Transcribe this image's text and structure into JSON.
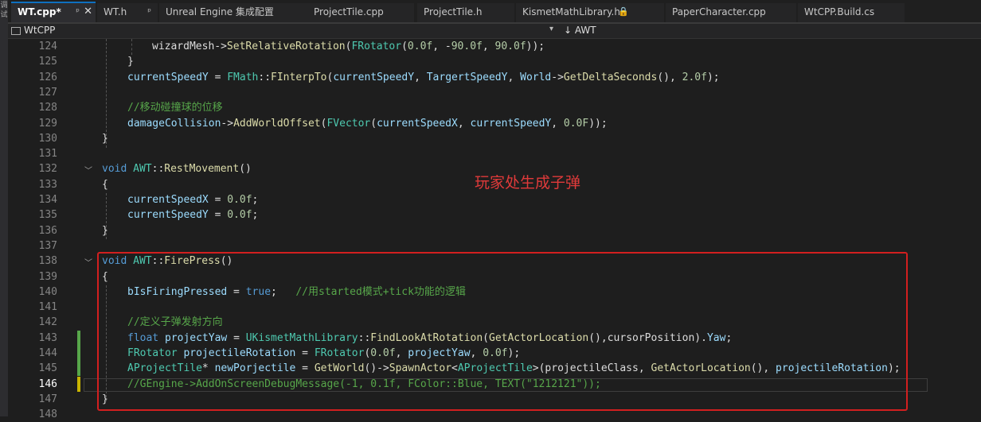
{
  "tabs": [
    {
      "label": "WT.cpp*",
      "active": true
    },
    {
      "label": "WT.h"
    },
    {
      "label": "Unreal Engine 集成配置"
    },
    {
      "label": "ProjectTile.cpp"
    },
    {
      "label": "ProjectTile.h"
    },
    {
      "label": "KismetMathLibrary.h"
    },
    {
      "label": "PaperCharacter.cpp"
    },
    {
      "label": "WtCPP.Build.cs"
    }
  ],
  "nav": {
    "project": "WtCPP",
    "class": "AWT"
  },
  "annotation": "玩家处生成子弹",
  "lines": [
    {
      "n": "124",
      "parts": [
        [
          "p",
          "wizardMesh->"
        ],
        [
          "f",
          "SetRelativeRotation"
        ],
        [
          "p",
          "("
        ],
        [
          "t",
          "FRotator"
        ],
        [
          "p",
          "("
        ],
        [
          "n",
          "0.0f"
        ],
        [
          "p",
          ", -"
        ],
        [
          "n",
          "90.0f"
        ],
        [
          "p",
          ", "
        ],
        [
          "n",
          "90.0f"
        ],
        [
          "p",
          "));"
        ]
      ]
    },
    {
      "n": "125",
      "parts": [
        [
          "p",
          "}"
        ]
      ]
    },
    {
      "n": "126",
      "parts": [
        [
          "v",
          "currentSpeedY"
        ],
        [
          "p",
          " = "
        ],
        [
          "t",
          "FMath"
        ],
        [
          "p",
          "::"
        ],
        [
          "f",
          "FInterpTo"
        ],
        [
          "p",
          "("
        ],
        [
          "v",
          "currentSpeedY"
        ],
        [
          "p",
          ", "
        ],
        [
          "v",
          "TargertSpeedY"
        ],
        [
          "p",
          ", "
        ],
        [
          "v",
          "World"
        ],
        [
          "p",
          "->"
        ],
        [
          "f",
          "GetDeltaSeconds"
        ],
        [
          "p",
          "(), "
        ],
        [
          "n",
          "2.0f"
        ],
        [
          "p",
          ");"
        ]
      ]
    },
    {
      "n": "127",
      "parts": []
    },
    {
      "n": "128",
      "parts": [
        [
          "c",
          "//移动碰撞球的位移"
        ]
      ]
    },
    {
      "n": "129",
      "parts": [
        [
          "v",
          "damageCollision"
        ],
        [
          "p",
          "->"
        ],
        [
          "f",
          "AddWorldOffset"
        ],
        [
          "p",
          "("
        ],
        [
          "t",
          "FVector"
        ],
        [
          "p",
          "("
        ],
        [
          "v",
          "currentSpeedX"
        ],
        [
          "p",
          ", "
        ],
        [
          "v",
          "currentSpeedY"
        ],
        [
          "p",
          ", "
        ],
        [
          "n",
          "0.0F"
        ],
        [
          "p",
          "));"
        ]
      ]
    },
    {
      "n": "130",
      "parts": [
        [
          "p",
          "}"
        ]
      ]
    },
    {
      "n": "131",
      "parts": []
    },
    {
      "n": "132",
      "parts": [
        [
          "k",
          "void"
        ],
        [
          "p",
          " "
        ],
        [
          "t",
          "AWT"
        ],
        [
          "p",
          "::"
        ],
        [
          "f",
          "RestMovement"
        ],
        [
          "p",
          "()"
        ]
      ]
    },
    {
      "n": "133",
      "parts": [
        [
          "p",
          "{"
        ]
      ]
    },
    {
      "n": "134",
      "parts": [
        [
          "v",
          "currentSpeedX"
        ],
        [
          "p",
          " = "
        ],
        [
          "n",
          "0.0f"
        ],
        [
          "p",
          ";"
        ]
      ]
    },
    {
      "n": "135",
      "parts": [
        [
          "v",
          "currentSpeedY"
        ],
        [
          "p",
          " = "
        ],
        [
          "n",
          "0.0f"
        ],
        [
          "p",
          ";"
        ]
      ]
    },
    {
      "n": "136",
      "parts": [
        [
          "p",
          "}"
        ]
      ]
    },
    {
      "n": "137",
      "parts": []
    },
    {
      "n": "138",
      "parts": [
        [
          "k",
          "void"
        ],
        [
          "p",
          " "
        ],
        [
          "t",
          "AWT"
        ],
        [
          "p",
          "::"
        ],
        [
          "f",
          "FirePress"
        ],
        [
          "p",
          "()"
        ]
      ]
    },
    {
      "n": "139",
      "parts": [
        [
          "p",
          "{"
        ]
      ]
    },
    {
      "n": "140",
      "parts": [
        [
          "v",
          "bIsFiringPressed"
        ],
        [
          "p",
          " = "
        ],
        [
          "k",
          "true"
        ],
        [
          "p",
          ";   "
        ],
        [
          "c",
          "//用started模式+tick功能的逻辑"
        ]
      ]
    },
    {
      "n": "141",
      "parts": []
    },
    {
      "n": "142",
      "parts": [
        [
          "c",
          "//定义子弹发射方向"
        ]
      ]
    },
    {
      "n": "143",
      "parts": [
        [
          "k",
          "float"
        ],
        [
          "p",
          " "
        ],
        [
          "v",
          "projectYaw"
        ],
        [
          "p",
          " = "
        ],
        [
          "t",
          "UKismetMathLibrary"
        ],
        [
          "p",
          "::"
        ],
        [
          "f",
          "FindLookAtRotation"
        ],
        [
          "p",
          "("
        ],
        [
          "f",
          "GetActorLocation"
        ],
        [
          "p",
          "(),cursorPosition)."
        ],
        [
          "v",
          "Yaw"
        ],
        [
          "p",
          ";"
        ]
      ]
    },
    {
      "n": "144",
      "parts": [
        [
          "t",
          "FRotator"
        ],
        [
          "p",
          " "
        ],
        [
          "v",
          "projectileRotation"
        ],
        [
          "p",
          " = "
        ],
        [
          "t",
          "FRotator"
        ],
        [
          "p",
          "("
        ],
        [
          "n",
          "0.0f"
        ],
        [
          "p",
          ", "
        ],
        [
          "v",
          "projectYaw"
        ],
        [
          "p",
          ", "
        ],
        [
          "n",
          "0.0f"
        ],
        [
          "p",
          ");"
        ]
      ]
    },
    {
      "n": "145",
      "parts": [
        [
          "t",
          "AProjectTile"
        ],
        [
          "p",
          "* "
        ],
        [
          "v",
          "newPorjectile"
        ],
        [
          "p",
          " = "
        ],
        [
          "f",
          "GetWorld"
        ],
        [
          "p",
          "()->"
        ],
        [
          "f",
          "SpawnActor"
        ],
        [
          "p",
          "<"
        ],
        [
          "t",
          "AProjectTile"
        ],
        [
          "p",
          ">(projectileClass, "
        ],
        [
          "f",
          "GetActorLocation"
        ],
        [
          "p",
          "(), "
        ],
        [
          "v",
          "projectileRotation"
        ],
        [
          "p",
          ");"
        ]
      ]
    },
    {
      "n": "146",
      "parts": [
        [
          "c",
          "//GEngine->AddOnScreenDebugMessage(-1, 0.1f, FColor::Blue, TEXT(\"1212121\"));"
        ]
      ]
    },
    {
      "n": "147",
      "parts": [
        [
          "p",
          "}"
        ]
      ]
    },
    {
      "n": "148",
      "parts": []
    }
  ]
}
